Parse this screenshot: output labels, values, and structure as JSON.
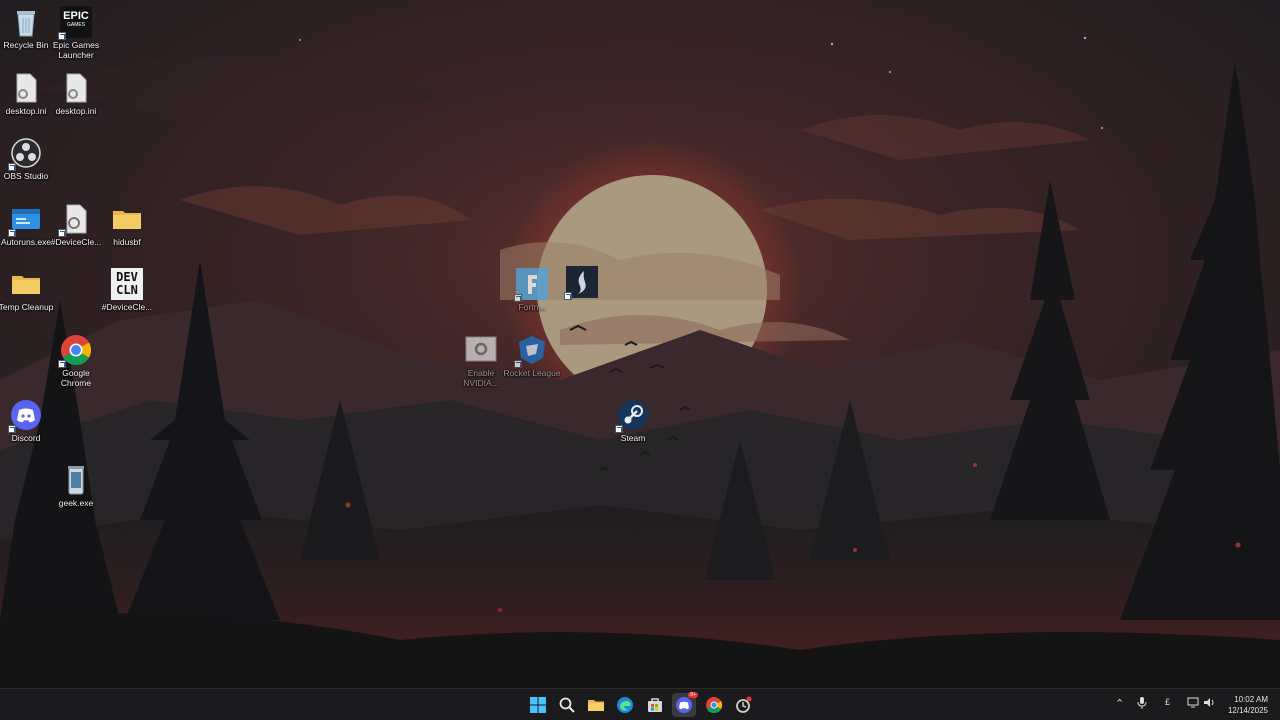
{
  "desktop": {
    "icons": {
      "recycle_bin": "Recycle Bin",
      "epic": "Epic Games Launcher",
      "epic_logo_top": "EPIC",
      "epic_logo_bottom": "GAMES",
      "desktop_ini_1": "desktop.ini",
      "desktop_ini_2": "desktop.ini",
      "obs": "OBS Studio",
      "autoruns": "Autoruns.exe",
      "devicecle_1": "#DeviceCle...",
      "hidusbf": "hidusbf",
      "temp_cleanup": "Temp Cleanup",
      "devcln_logo": "DEV CLN",
      "devicecle_2": "#DeviceCle...",
      "chrome": "Google Chrome",
      "discord": "Discord",
      "geek": "geek.exe",
      "fortnite": "Fortn...",
      "enable_nvidia": "Enable NVIDIA...",
      "rocket_league": "Rocket League",
      "steam": "Steam"
    }
  },
  "taskbar": {
    "discord_badge": "9+",
    "tray_lang": "£",
    "time": "10:02 AM",
    "date": "12/14/2025"
  },
  "colors": {
    "taskbar_bg": "#1b1b1d",
    "accent": "#2b8ee8",
    "sun": "#d9c4a3"
  }
}
